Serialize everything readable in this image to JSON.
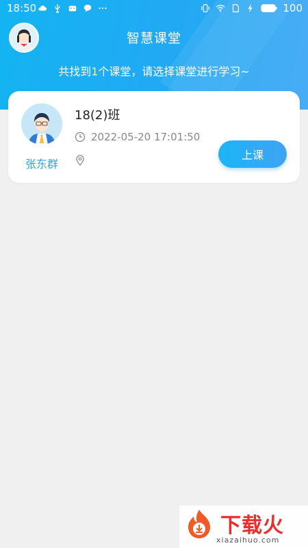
{
  "status_bar": {
    "time": "18:50",
    "left_icons": [
      "cloud-icon",
      "usb-icon",
      "android-icon",
      "chat-icon",
      "more-icon"
    ],
    "right_icons": [
      "vibrate-icon",
      "wifi-icon",
      "sim-icon",
      "charging-icon",
      "battery-icon"
    ],
    "battery": "100"
  },
  "header": {
    "title": "智慧课堂",
    "subtitle_prefix": "共找到",
    "subtitle_count": "1",
    "subtitle_suffix": "个课堂，请选择课堂进行学习~",
    "accent": "#1cb1f2"
  },
  "classroom": {
    "teacher_name": "张东群",
    "class_name": "18(2)班",
    "time": "2022-05-20 17:01:50",
    "location": "",
    "button_label": "上课"
  },
  "watermark": {
    "brand": "下载火",
    "url": "xiazaihuo.com"
  }
}
